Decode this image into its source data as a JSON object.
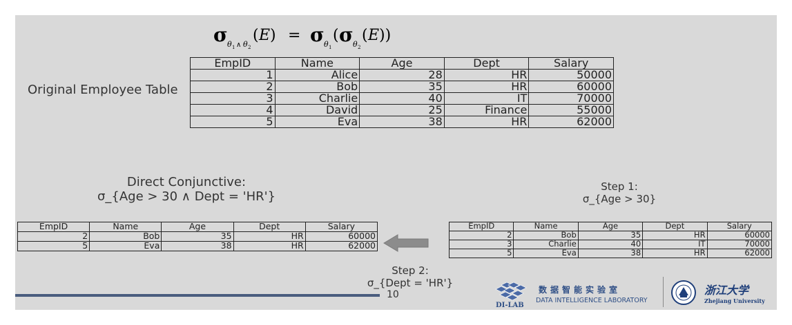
{
  "formula": {
    "sigma": "σ",
    "theta": "θ",
    "sub1": "1",
    "sub2": "2",
    "and": "∧",
    "E": "E",
    "lparen": "(",
    "rparen": ")",
    "rparen2": "))",
    "equals": "="
  },
  "original_table": {
    "label": "Original Employee Table",
    "columns": [
      "EmpID",
      "Name",
      "Age",
      "Dept",
      "Salary"
    ],
    "rows": [
      [
        "1",
        "Alice",
        "28",
        "HR",
        "50000"
      ],
      [
        "2",
        "Bob",
        "35",
        "HR",
        "60000"
      ],
      [
        "3",
        "Charlie",
        "40",
        "IT",
        "70000"
      ],
      [
        "4",
        "David",
        "25",
        "Finance",
        "55000"
      ],
      [
        "5",
        "Eva",
        "38",
        "HR",
        "62000"
      ]
    ]
  },
  "direct": {
    "title": "Direct Conjunctive:",
    "expression": "σ_{Age > 30 ∧ Dept = 'HR'}"
  },
  "result_table": {
    "columns": [
      "EmpID",
      "Name",
      "Age",
      "Dept",
      "Salary"
    ],
    "rows": [
      [
        "2",
        "Bob",
        "35",
        "HR",
        "60000"
      ],
      [
        "5",
        "Eva",
        "38",
        "HR",
        "62000"
      ]
    ]
  },
  "step1": {
    "title": "Step 1:",
    "expression": "σ_{Age > 30}"
  },
  "step1_table": {
    "columns": [
      "EmpID",
      "Name",
      "Age",
      "Dept",
      "Salary"
    ],
    "rows": [
      [
        "2",
        "Bob",
        "35",
        "HR",
        "60000"
      ],
      [
        "3",
        "Charlie",
        "40",
        "IT",
        "70000"
      ],
      [
        "5",
        "Eva",
        "38",
        "HR",
        "62000"
      ]
    ]
  },
  "step2": {
    "title": "Step 2:",
    "expression": "σ_{Dept = 'HR'}"
  },
  "footer": {
    "page_number": "10",
    "lab_name_cn": "数据智能实验室",
    "lab_name_en": "DATA INTELLIGENCE LABORATORY",
    "lab_logo_text": "DI-LAB",
    "univ_name_cn": "浙江大学",
    "univ_name_en": "Zhejiang University"
  },
  "colors": {
    "slide_bg": "#d9d9d9",
    "rule": "#4a5d7e",
    "arrow": "#8c8c8c",
    "brand_blue": "#2f4f86"
  },
  "icons": [
    "left-arrow-icon",
    "dilab-logo",
    "zju-emblem"
  ]
}
